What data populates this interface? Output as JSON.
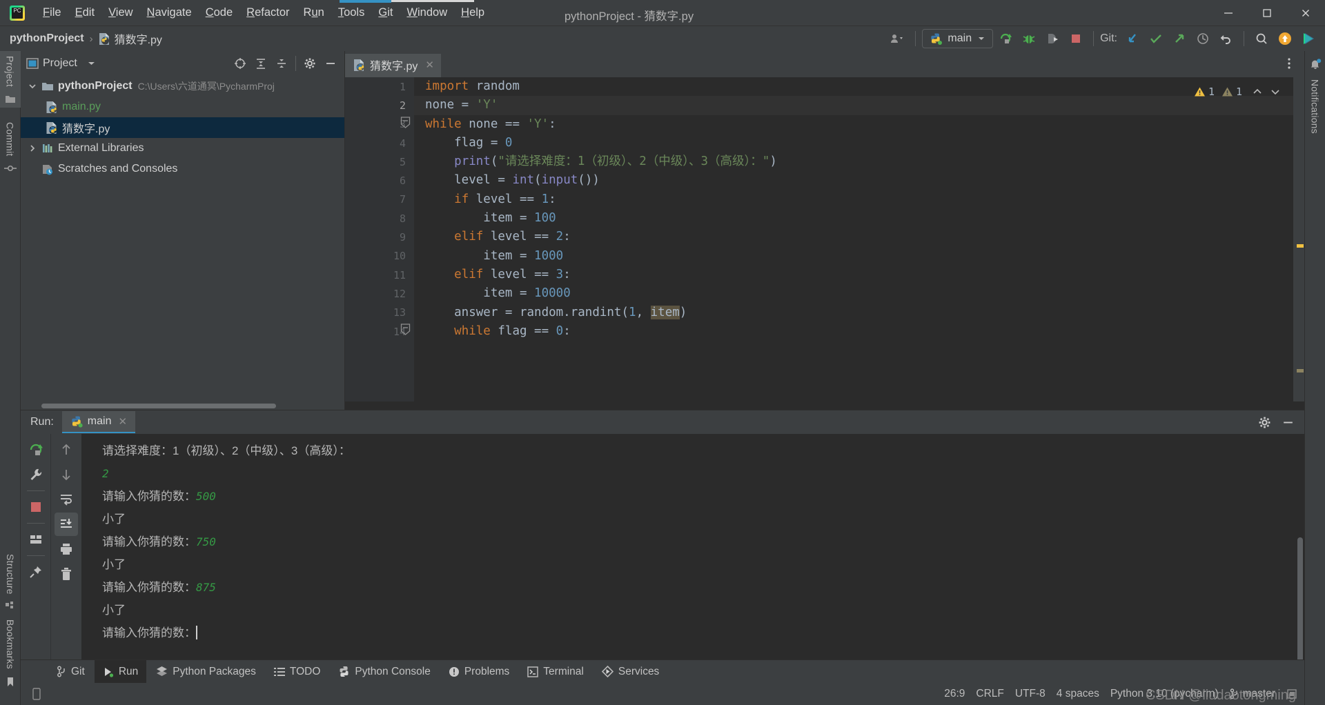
{
  "titlebar": {
    "logo_icon": "pycharm-logo-icon",
    "window_title": "pythonProject - 猜数字.py",
    "menus": [
      {
        "label": "File",
        "mnemonic": "F"
      },
      {
        "label": "Edit",
        "mnemonic": "E"
      },
      {
        "label": "View",
        "mnemonic": "V"
      },
      {
        "label": "Navigate",
        "mnemonic": "N"
      },
      {
        "label": "Code",
        "mnemonic": "C"
      },
      {
        "label": "Refactor",
        "mnemonic": "R"
      },
      {
        "label": "Run",
        "mnemonic": "u"
      },
      {
        "label": "Tools",
        "mnemonic": "T"
      },
      {
        "label": "Git",
        "mnemonic": "G"
      },
      {
        "label": "Window",
        "mnemonic": "W"
      },
      {
        "label": "Help",
        "mnemonic": "H"
      }
    ],
    "controls": [
      "minimize-icon",
      "maximize-icon",
      "close-icon"
    ]
  },
  "navbar": {
    "breadcrumb_project": "pythonProject",
    "breadcrumb_separator": "›",
    "breadcrumb_file": "猜数字.py",
    "run_config": "main",
    "git_label": "Git:",
    "icons": [
      "user-dropdown-icon",
      "run-icon",
      "debug-icon",
      "coverage-icon",
      "stop-icon",
      "git-update-icon",
      "git-commit-icon",
      "git-push-icon",
      "git-history-icon",
      "git-rollback-icon",
      "search-everywhere-icon",
      "updates-icon",
      "feedback-icon"
    ]
  },
  "left_rail": {
    "items": [
      {
        "label": "Project",
        "icon": "project-folder-icon",
        "active": true
      },
      {
        "label": "Commit",
        "icon": "commit-icon",
        "active": false
      },
      {
        "label": "Bookmarks",
        "icon": "bookmark-icon",
        "active": false
      },
      {
        "label": "Structure",
        "icon": "structure-icon",
        "active": false
      }
    ]
  },
  "right_rail": {
    "items": [
      {
        "label": "Notifications",
        "icon": "bell-icon"
      }
    ]
  },
  "project_panel": {
    "title": "Project",
    "dropdown_icon": "chevron-down-icon",
    "header_icons": [
      "select-opened-file-icon",
      "expand-all-icon",
      "collapse-all-icon",
      "settings-gear-icon",
      "hide-icon"
    ],
    "tree": [
      {
        "label": "pythonProject",
        "path": "C:\\Users\\六道通冥\\PycharmProj",
        "icon": "folder-icon",
        "twist": "expanded",
        "depth": 0,
        "bold": true,
        "selected": false
      },
      {
        "label": "main.py",
        "path": "",
        "icon": "python-file-icon",
        "twist": "none",
        "depth": 1,
        "bold": false,
        "selected": false,
        "green": true
      },
      {
        "label": "猜数字.py",
        "path": "",
        "icon": "python-file-icon",
        "twist": "none",
        "depth": 1,
        "bold": false,
        "selected": true
      },
      {
        "label": "External Libraries",
        "path": "",
        "icon": "libraries-icon",
        "twist": "collapsed",
        "depth": 0,
        "bold": false,
        "selected": false
      },
      {
        "label": "Scratches and Consoles",
        "path": "",
        "icon": "scratches-icon",
        "twist": "none",
        "depth": 0,
        "bold": false,
        "selected": false
      }
    ]
  },
  "editor": {
    "tab": {
      "label": "猜数字.py",
      "icon": "python-file-icon",
      "close_icon": "close-icon"
    },
    "inspection": {
      "warning_count": "1",
      "weak_warning_count": "1",
      "warning_icon": "warning-triangle-icon",
      "weak_warning_icon": "weak-warning-triangle-icon",
      "prev_icon": "chevron-up-icon",
      "next_icon": "chevron-down-icon"
    },
    "more_icon": "more-vertical-icon",
    "lines": [
      {
        "n": "1",
        "fold": "",
        "tokens": [
          {
            "t": "import",
            "c": "kw"
          },
          {
            "t": " random",
            "c": "pl"
          }
        ]
      },
      {
        "n": "2",
        "fold": "",
        "tokens": [
          {
            "t": "none ",
            "c": "pl"
          },
          {
            "t": "= ",
            "c": "pl"
          },
          {
            "t": "'Y'",
            "c": "str"
          }
        ]
      },
      {
        "n": "3",
        "fold": "minus",
        "tokens": [
          {
            "t": "while",
            "c": "kw"
          },
          {
            "t": " none == ",
            "c": "pl"
          },
          {
            "t": "'Y'",
            "c": "str"
          },
          {
            "t": ":",
            "c": "pl"
          }
        ]
      },
      {
        "n": "4",
        "fold": "",
        "tokens": [
          {
            "t": "    flag = ",
            "c": "pl"
          },
          {
            "t": "0",
            "c": "num"
          }
        ]
      },
      {
        "n": "5",
        "fold": "",
        "tokens": [
          {
            "t": "    ",
            "c": "pl"
          },
          {
            "t": "print",
            "c": "builtin"
          },
          {
            "t": "(",
            "c": "pl"
          },
          {
            "t": "\"请选择难度：1（初级）、2（中级）、3（高级）：\"",
            "c": "str"
          },
          {
            "t": ")",
            "c": "pl"
          }
        ]
      },
      {
        "n": "6",
        "fold": "",
        "tokens": [
          {
            "t": "    level = ",
            "c": "pl"
          },
          {
            "t": "int",
            "c": "builtin"
          },
          {
            "t": "(",
            "c": "pl"
          },
          {
            "t": "input",
            "c": "builtin"
          },
          {
            "t": "())",
            "c": "pl"
          }
        ]
      },
      {
        "n": "7",
        "fold": "",
        "tokens": [
          {
            "t": "    ",
            "c": "pl"
          },
          {
            "t": "if",
            "c": "kw"
          },
          {
            "t": " level == ",
            "c": "pl"
          },
          {
            "t": "1",
            "c": "num"
          },
          {
            "t": ":",
            "c": "pl"
          }
        ]
      },
      {
        "n": "8",
        "fold": "",
        "tokens": [
          {
            "t": "        item = ",
            "c": "pl"
          },
          {
            "t": "100",
            "c": "num"
          }
        ]
      },
      {
        "n": "9",
        "fold": "",
        "tokens": [
          {
            "t": "    ",
            "c": "pl"
          },
          {
            "t": "elif",
            "c": "kw"
          },
          {
            "t": " level == ",
            "c": "pl"
          },
          {
            "t": "2",
            "c": "num"
          },
          {
            "t": ":",
            "c": "pl"
          }
        ]
      },
      {
        "n": "10",
        "fold": "",
        "tokens": [
          {
            "t": "        item = ",
            "c": "pl"
          },
          {
            "t": "1000",
            "c": "num"
          }
        ]
      },
      {
        "n": "11",
        "fold": "",
        "tokens": [
          {
            "t": "    ",
            "c": "pl"
          },
          {
            "t": "elif",
            "c": "kw"
          },
          {
            "t": " level == ",
            "c": "pl"
          },
          {
            "t": "3",
            "c": "num"
          },
          {
            "t": ":",
            "c": "pl"
          }
        ]
      },
      {
        "n": "12",
        "fold": "",
        "tokens": [
          {
            "t": "        item = ",
            "c": "pl"
          },
          {
            "t": "10000",
            "c": "num"
          }
        ]
      },
      {
        "n": "13",
        "fold": "",
        "tokens": [
          {
            "t": "    answer = random.randint(",
            "c": "pl"
          },
          {
            "t": "1",
            "c": "num"
          },
          {
            "t": ", ",
            "c": "pl"
          },
          {
            "t": "item",
            "c": "hlbox"
          },
          {
            "t": ")",
            "c": "pl"
          }
        ]
      },
      {
        "n": "14",
        "fold": "minus",
        "tokens": [
          {
            "t": "    ",
            "c": "pl"
          },
          {
            "t": "while",
            "c": "kw"
          },
          {
            "t": " flag == ",
            "c": "pl"
          },
          {
            "t": "0",
            "c": "num"
          },
          {
            "t": ":",
            "c": "pl"
          }
        ]
      }
    ]
  },
  "run_panel": {
    "label": "Run:",
    "tab": {
      "label": "main",
      "icon": "python-run-icon",
      "close_icon": "close-icon"
    },
    "header_icons": [
      "settings-gear-icon",
      "hide-icon"
    ],
    "tools_left": [
      "rerun-icon",
      "wrench-icon",
      "stop-icon",
      "layout-icon",
      "pin-icon"
    ],
    "tools_right": [
      "up-arrow-icon",
      "down-arrow-icon",
      "soft-wrap-icon",
      "scroll-to-end-icon",
      "print-icon",
      "trash-icon"
    ],
    "console": [
      {
        "text": "请选择难度：1（初级）、2（中级）、3（高级）：",
        "input": "",
        "caret": false
      },
      {
        "text": "",
        "input": "2",
        "caret": false
      },
      {
        "text": "请输入你猜的数：",
        "input": "500",
        "caret": false
      },
      {
        "text": "小了",
        "input": "",
        "caret": false
      },
      {
        "text": "请输入你猜的数：",
        "input": "750",
        "caret": false
      },
      {
        "text": "小了",
        "input": "",
        "caret": false
      },
      {
        "text": "请输入你猜的数：",
        "input": "875",
        "caret": false
      },
      {
        "text": "小了",
        "input": "",
        "caret": false
      },
      {
        "text": "请输入你猜的数：",
        "input": "",
        "caret": true
      }
    ]
  },
  "toolwindow_bar": {
    "items": [
      {
        "label": "Git",
        "icon": "git-branch-icon",
        "active": false
      },
      {
        "label": "Run",
        "icon": "run-play-icon",
        "active": true
      },
      {
        "label": "Python Packages",
        "icon": "packages-icon",
        "active": false
      },
      {
        "label": "TODO",
        "icon": "todo-list-icon",
        "active": false
      },
      {
        "label": "Python Console",
        "icon": "python-console-icon",
        "active": false
      },
      {
        "label": "Problems",
        "icon": "problems-icon",
        "active": false
      },
      {
        "label": "Terminal",
        "icon": "terminal-icon",
        "active": false
      },
      {
        "label": "Services",
        "icon": "services-icon",
        "active": false
      }
    ]
  },
  "statusbar": {
    "caret_position": "26:9",
    "line_separator": "CRLF",
    "encoding": "UTF-8",
    "indent": "4 spaces",
    "interpreter": "Python 3.10 (pycharm)",
    "branch": "master",
    "branch_icon": "git-branch-icon",
    "memory_icon": "memory-indicator-icon",
    "watermark": "CSDN @liudaotongming"
  },
  "colors": {
    "accent_blue": "#3592c4",
    "editor_bg": "#2b2b2b",
    "panel_bg": "#3c3f41",
    "selection_bg": "#0d293e",
    "keyword": "#cc7832",
    "string": "#6a8759",
    "number": "#6897bb",
    "plain": "#a9b7c6"
  }
}
